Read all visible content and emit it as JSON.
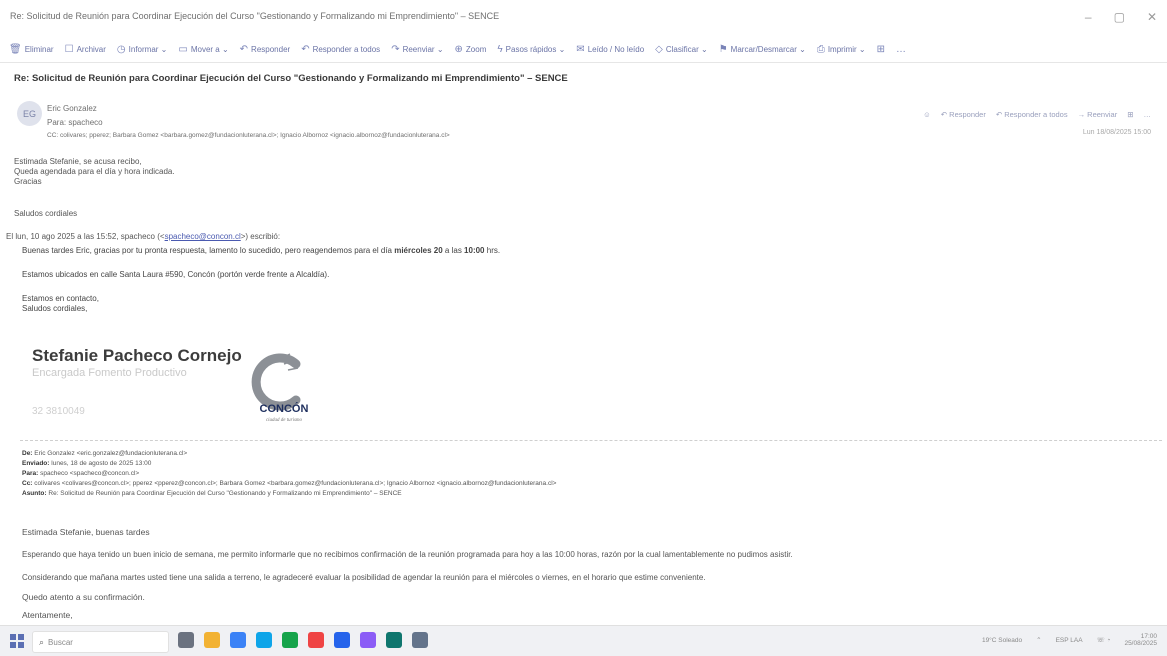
{
  "window": {
    "title": "Re: Solicitud de Reunión para Coordinar Ejecución del Curso \"Gestionando y Formalizando mi Emprendimiento\" – SENCE",
    "controls": [
      "–",
      "▢",
      "✕"
    ]
  },
  "toolbar": {
    "items": [
      {
        "icon": "trash-icon",
        "glyph": "🗑",
        "label": "Eliminar"
      },
      {
        "icon": "archive-icon",
        "glyph": "☐",
        "label": "Archivar"
      },
      {
        "icon": "report-icon",
        "glyph": "◷",
        "label": "Informar ⌄"
      },
      {
        "icon": "move-icon",
        "glyph": "▭",
        "label": "Mover a ⌄"
      },
      {
        "icon": "reply-icon",
        "glyph": "↶",
        "label": "Responder"
      },
      {
        "icon": "reply-all-icon",
        "glyph": "↶",
        "label": "Responder a todos"
      },
      {
        "icon": "forward-icon",
        "glyph": "↷",
        "label": "Reenviar ⌄"
      },
      {
        "icon": "zoom-icon",
        "glyph": "⊕",
        "label": "Zoom"
      },
      {
        "icon": "quick-steps-icon",
        "glyph": "ϟ",
        "label": "Pasos rápidos ⌄"
      },
      {
        "icon": "read-unread-icon",
        "glyph": "✉",
        "label": "Leído / No leído"
      },
      {
        "icon": "classify-icon",
        "glyph": "◇",
        "label": "Clasificar ⌄"
      },
      {
        "icon": "flag-icon",
        "glyph": "⚑",
        "label": "Marcar/Desmarcar ⌄"
      },
      {
        "icon": "print-icon",
        "glyph": "⎙",
        "label": "Imprimir ⌄"
      },
      {
        "icon": "translate-icon",
        "glyph": "⊞",
        "label": ""
      },
      {
        "icon": "more-icon",
        "glyph": "…",
        "label": ""
      }
    ]
  },
  "subject": "Re: Solicitud de Reunión para Coordinar Ejecución del Curso \"Gestionando y Formalizando mi Emprendimiento\" – SENCE",
  "message": {
    "avatar_initials": "EG",
    "from": "Eric Gonzalez",
    "to": "Para: spacheco",
    "cc": "CC: colivares; pperez; Barbara Gomez <barbara.gomez@fundacionluterana.cl>; Ignacio Albornoz <ignacio.albornoz@fundacionluterana.cl>",
    "actions": [
      "☺",
      "↶ Responder",
      "↶ Responder a todos",
      "→ Reenviar",
      "⊞",
      "…"
    ],
    "date": "Lun 18/08/2025 15:00",
    "body_lines": [
      "Estimada Stefanie, se acusa recibo,",
      "Queda agendada para el día y hora indicada.",
      "Gracias"
    ],
    "regards": "Saludos cordiales"
  },
  "quote": {
    "intro_prefix": "El lun, 10 ago 2025 a las 15:52, spacheco (<",
    "intro_email": "spacheco@concon.cl",
    "intro_suffix": ">) escribió:",
    "p1_prefix": "Buenas tardes Eric, gracias por tu pronta respuesta, lamento lo sucedido, pero reagendemos para el día ",
    "p1_bold1": "miércoles 20",
    "p1_mid": " a las ",
    "p1_bold2": "10:00",
    "p1_suffix": " hrs.",
    "p2": "Estamos ubicados en calle Santa Laura #590, Concón (portón verde frente a Alcaldía).",
    "p3a": "Estamos en contacto,",
    "p3b": "Saludos cordiales,"
  },
  "signature": {
    "name": "Stefanie Pacheco Cornejo",
    "role": "Encargada Fomento Productivo",
    "phone": "32 3810049",
    "logo_text": "CONCÓN",
    "logo_tagline": "ciudad de turismo"
  },
  "forward": {
    "from_label": "De:",
    "from": "Eric Gonzalez <eric.gonzalez@fundacionluterana.cl>",
    "sent_label": "Enviado:",
    "sent": "lunes, 18 de agosto de 2025 13:00",
    "to_label": "Para:",
    "to": "spacheco <spacheco@concon.cl>",
    "cc_label": "Cc:",
    "cc": "colivares <colivares@concon.cl>; pperez <pperez@concon.cl>; Barbara Gomez <barbara.gomez@fundacionluterana.cl>; Ignacio Albornoz <ignacio.albornoz@fundacionluterana.cl>",
    "subject_label": "Asunto:",
    "subject": "Re: Solicitud de Reunión para Coordinar Ejecución del Curso \"Gestionando y Formalizando mi Emprendimiento\" – SENCE"
  },
  "body2": {
    "greeting": "Estimada Stefanie, buenas tardes",
    "l1": "Esperando que haya tenido un buen inicio de semana, me permito informarle que no recibimos confirmación de la reunión programada para hoy a las 10:00 horas, razón por la cual lamentablemente no pudimos asistir.",
    "l2": "Considerando que mañana martes usted tiene una salida a terreno, le agradeceré evaluar la posibilidad de agendar la reunión para el miércoles o viernes, en el horario que estime conveniente.",
    "l3": "Quedo atento a su confirmación.",
    "l4": "Atentamente,"
  },
  "taskbar": {
    "search_placeholder": "Buscar",
    "weather": "19°C Soleado",
    "lang": "ESP LAA",
    "time": "17:00",
    "date": "25/08/2025",
    "app_colors": [
      "#6b7280",
      "#f2b233",
      "#3b82f6",
      "#0ea5e9",
      "#16a34a",
      "#ef4444",
      "#2563eb",
      "#8b5cf6",
      "#0f766e",
      "#64748b"
    ]
  }
}
